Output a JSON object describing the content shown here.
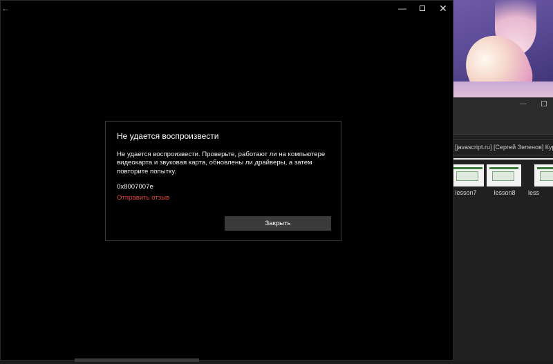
{
  "player": {
    "back_icon": "arrow-left-icon",
    "controls": {
      "minimize": "minimize-icon",
      "maximize": "maximize-icon",
      "close": "close-icon"
    }
  },
  "dialog": {
    "title": "Не удается воспроизвести",
    "message": "Не удается воспроизвести. Проверьте, работают ли на компьютере видеокарта и звуковая карта, обновлены ли драйверы, а затем повторите попытку.",
    "error_code": "0x8007007e",
    "feedback_link": "Отправить отзыв",
    "close_button": "Закрыть",
    "link_color": "#e0463b"
  },
  "explorer": {
    "address_text": "[javascript.ru] [Сергей Зеленов] Курс по",
    "thumbnails": [
      {
        "label": "lesson7"
      },
      {
        "label": "lesson8"
      },
      {
        "label": "less"
      }
    ]
  }
}
